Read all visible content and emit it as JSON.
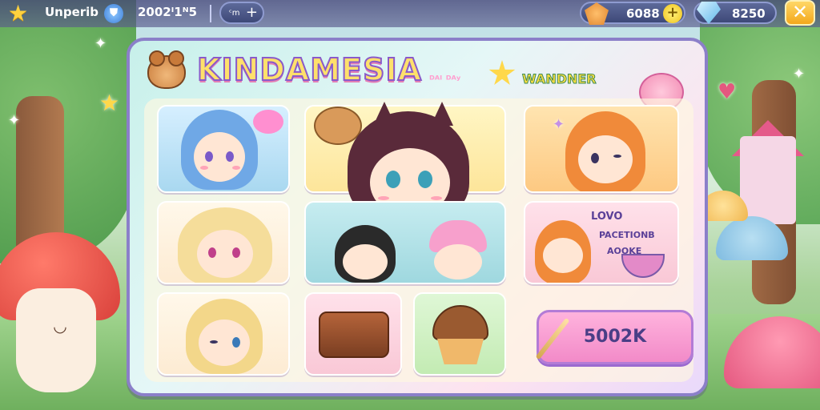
{
  "topbar": {
    "player_name": "Unperib",
    "badge_icon": "shield-badge-icon",
    "score": "2002ᴵ1ᴺ5",
    "tag_label": "ᶜm",
    "coins": "6088",
    "gems": "8250"
  },
  "panel": {
    "title": "KINDAMESIA",
    "subtitle": "ᴰᴬᴵ ᴰᴬʸ",
    "wonder_label": "WANDNER",
    "food_card": {
      "line1": "LOVO",
      "line2": "PACETIONB",
      "line3": "AOOKE"
    },
    "shop_button": "5002K"
  },
  "colors": {
    "accent": "#8b7fc9",
    "title_fill": "#ffe06b",
    "button_pink": "#f28ac8",
    "coin_gold": "#f0c21b"
  }
}
